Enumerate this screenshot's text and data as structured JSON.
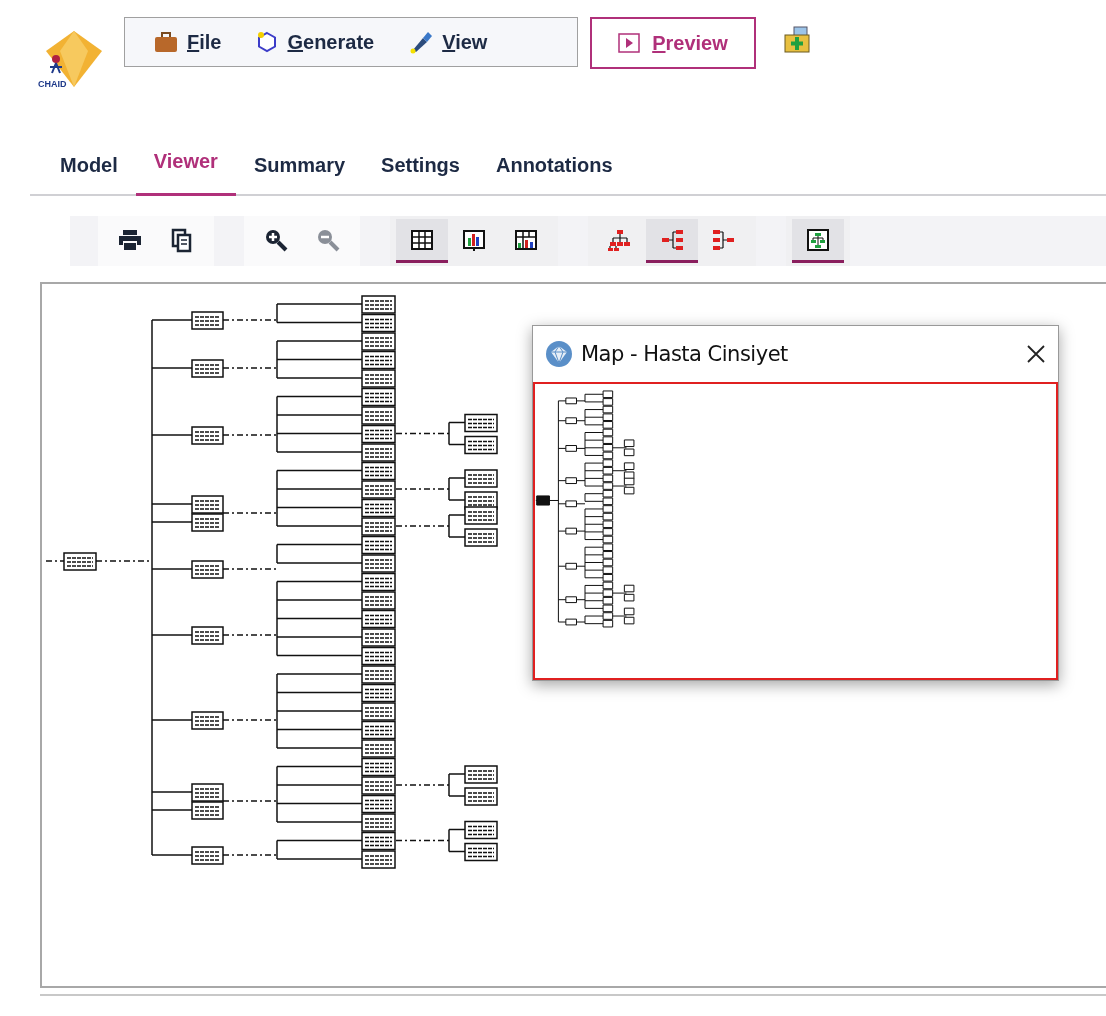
{
  "logo": {
    "label": "CHAID"
  },
  "menu": [
    {
      "kind": "file",
      "label": "File",
      "underline_first": true
    },
    {
      "kind": "generate",
      "label": "Generate",
      "underline_first": true
    },
    {
      "kind": "view",
      "label": "View",
      "underline_first": true
    }
  ],
  "preview": {
    "label": "Preview",
    "underline_first": true
  },
  "tabs": [
    {
      "label": "Model",
      "selected": false
    },
    {
      "label": "Viewer",
      "selected": true
    },
    {
      "label": "Summary",
      "selected": false
    },
    {
      "label": "Settings",
      "selected": false
    },
    {
      "label": "Annotations",
      "selected": false
    }
  ],
  "toolbar": [
    {
      "items": [
        {
          "kind": "print"
        },
        {
          "kind": "copy"
        }
      ]
    },
    {
      "items": [
        {
          "kind": "zoom-in",
          "disabled": false
        },
        {
          "kind": "zoom-out",
          "disabled": true
        }
      ]
    },
    {
      "items": [
        {
          "kind": "table",
          "selected": true
        },
        {
          "kind": "chart",
          "selected": false
        },
        {
          "kind": "table-chart",
          "selected": false
        }
      ]
    },
    {
      "items": [
        {
          "kind": "tree-top",
          "selected": false
        },
        {
          "kind": "tree-left",
          "selected": true
        },
        {
          "kind": "tree-right",
          "selected": false
        }
      ]
    },
    {
      "items": [
        {
          "kind": "map",
          "selected": true
        }
      ]
    }
  ],
  "map_window": {
    "title": "Map - Hasta Cinsiyet"
  }
}
